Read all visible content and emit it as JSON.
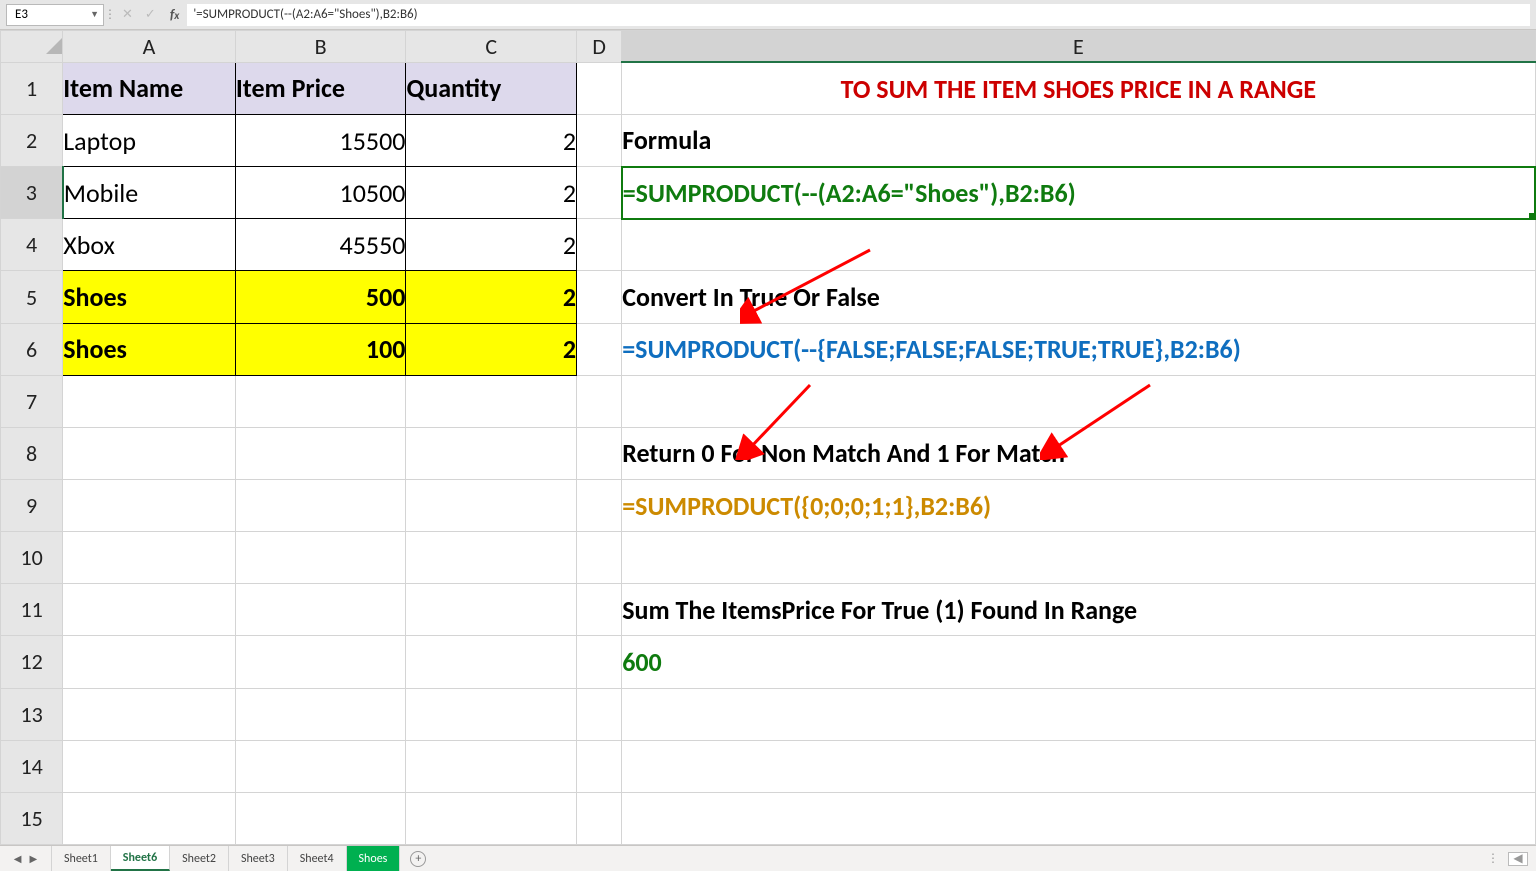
{
  "nameBox": "E3",
  "formulaBarText": "'=SUMPRODUCT(--(A2:A6=\"Shoes\"),B2:B6)",
  "columns": [
    "A",
    "B",
    "C",
    "D",
    "E"
  ],
  "rowCount": 15,
  "dataTable": {
    "headers": {
      "A": "Item Name",
      "B": "Item Price",
      "C": "Quantity"
    },
    "rows": [
      {
        "A": "Laptop",
        "B": "15500",
        "C": "2",
        "hl": false
      },
      {
        "A": "Mobile",
        "B": "10500",
        "C": "2",
        "hl": false
      },
      {
        "A": "Xbox",
        "B": "45550",
        "C": "2",
        "hl": false
      },
      {
        "A": "Shoes",
        "B": "500",
        "C": "2",
        "hl": true
      },
      {
        "A": "Shoes",
        "B": "100",
        "C": "2",
        "hl": true
      }
    ]
  },
  "eColumn": {
    "1": {
      "text": "TO SUM THE ITEM SHOES PRICE IN A RANGE",
      "cls": "etitle"
    },
    "2": {
      "text": "Formula",
      "cls": "bold left"
    },
    "3": {
      "text": "=SUMPRODUCT(--(A2:A6=\"Shoes\"),B2:B6)",
      "cls": "selected left"
    },
    "5": {
      "text": "Convert In True Or False",
      "cls": "bold left"
    },
    "6": {
      "text": "=SUMPRODUCT(--{FALSE;FALSE;FALSE;TRUE;TRUE},B2:B6)",
      "cls": "blue-bold left"
    },
    "8": {
      "text": "Return 0 For Non Match And 1 For Match",
      "cls": "bold left"
    },
    "9": {
      "text": "=SUMPRODUCT({0;0;0;1;1},B2:B6)",
      "cls": "orange-bold left"
    },
    "11": {
      "text": "Sum The ItemsPrice For True (1) Found In Range",
      "cls": "bold left"
    },
    "12": {
      "text": "600",
      "cls": "green-bold left"
    }
  },
  "tabs": [
    {
      "label": "Sheet1",
      "state": ""
    },
    {
      "label": "Sheet6",
      "state": "active"
    },
    {
      "label": "Sheet2",
      "state": ""
    },
    {
      "label": "Sheet3",
      "state": ""
    },
    {
      "label": "Sheet4",
      "state": ""
    },
    {
      "label": "Shoes",
      "state": "green"
    }
  ]
}
